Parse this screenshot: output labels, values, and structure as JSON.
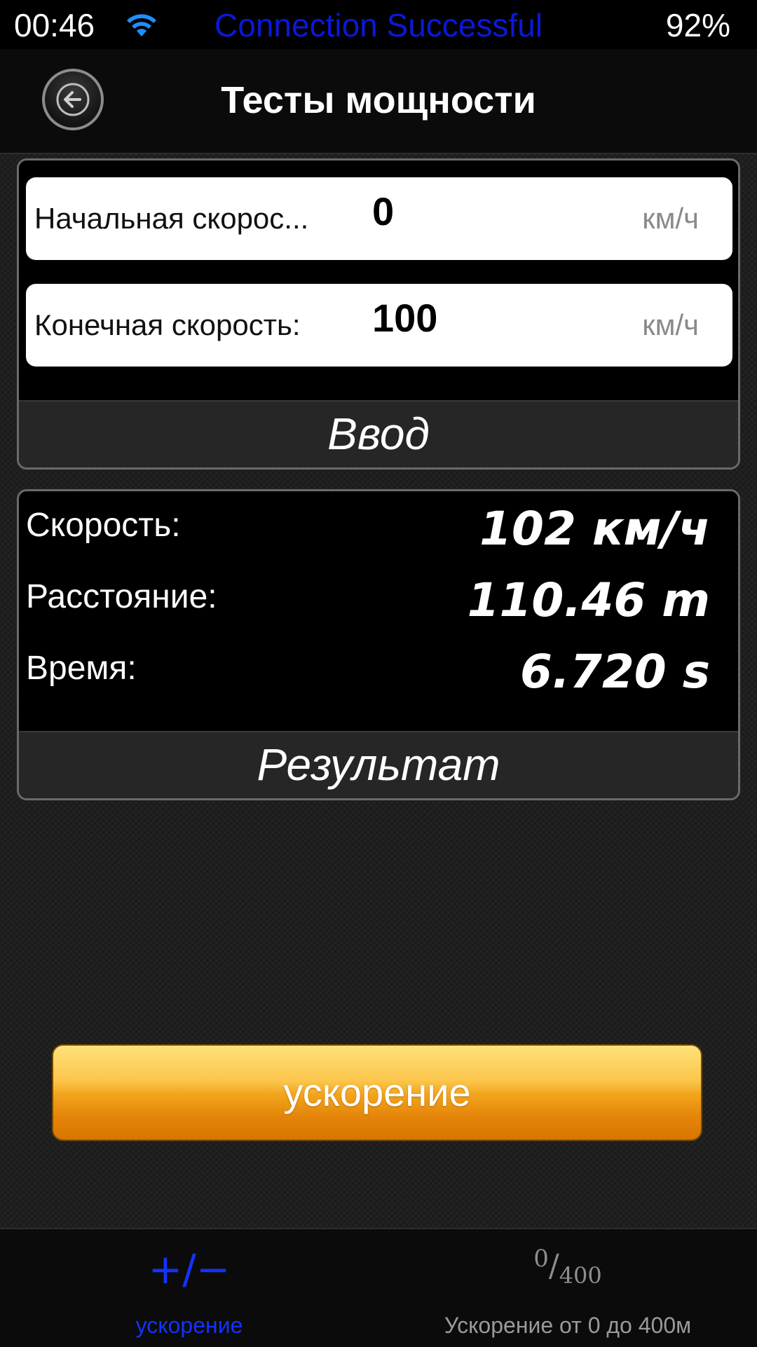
{
  "status_bar": {
    "time": "00:46",
    "wifi_icon": "wifi-icon",
    "title": "Connection Successful",
    "battery": "92%",
    "title_color": "#0a19d8"
  },
  "nav": {
    "back_icon": "back-arrow-circle-icon",
    "title": "Тесты мощности"
  },
  "input_panel": {
    "start_speed": {
      "label": "Начальная скорос...",
      "value": "0",
      "unit": "км/ч"
    },
    "end_speed": {
      "label": "Конечная скорость:",
      "value": "100",
      "unit": "км/ч"
    },
    "footer_label": "Ввод"
  },
  "result_panel": {
    "rows": [
      {
        "label": "Скорость:",
        "value": "102 км/ч"
      },
      {
        "label": "Расстояние:",
        "value": "110.46 m"
      },
      {
        "label": "Время:",
        "value": "6.720 s"
      }
    ],
    "footer_label": "Результат"
  },
  "action_button": {
    "label": "ускорение",
    "color": "#f2a51c"
  },
  "tab_bar": {
    "tabs": [
      {
        "icon_text": "+/−",
        "label": "ускорение",
        "active": true,
        "color": "#1432ff"
      },
      {
        "icon_top": "0",
        "icon_slash": "/",
        "icon_bottom": "400",
        "label": "Ускорение от 0 до 400м",
        "active": false,
        "color": "#9a9a9a"
      }
    ]
  }
}
